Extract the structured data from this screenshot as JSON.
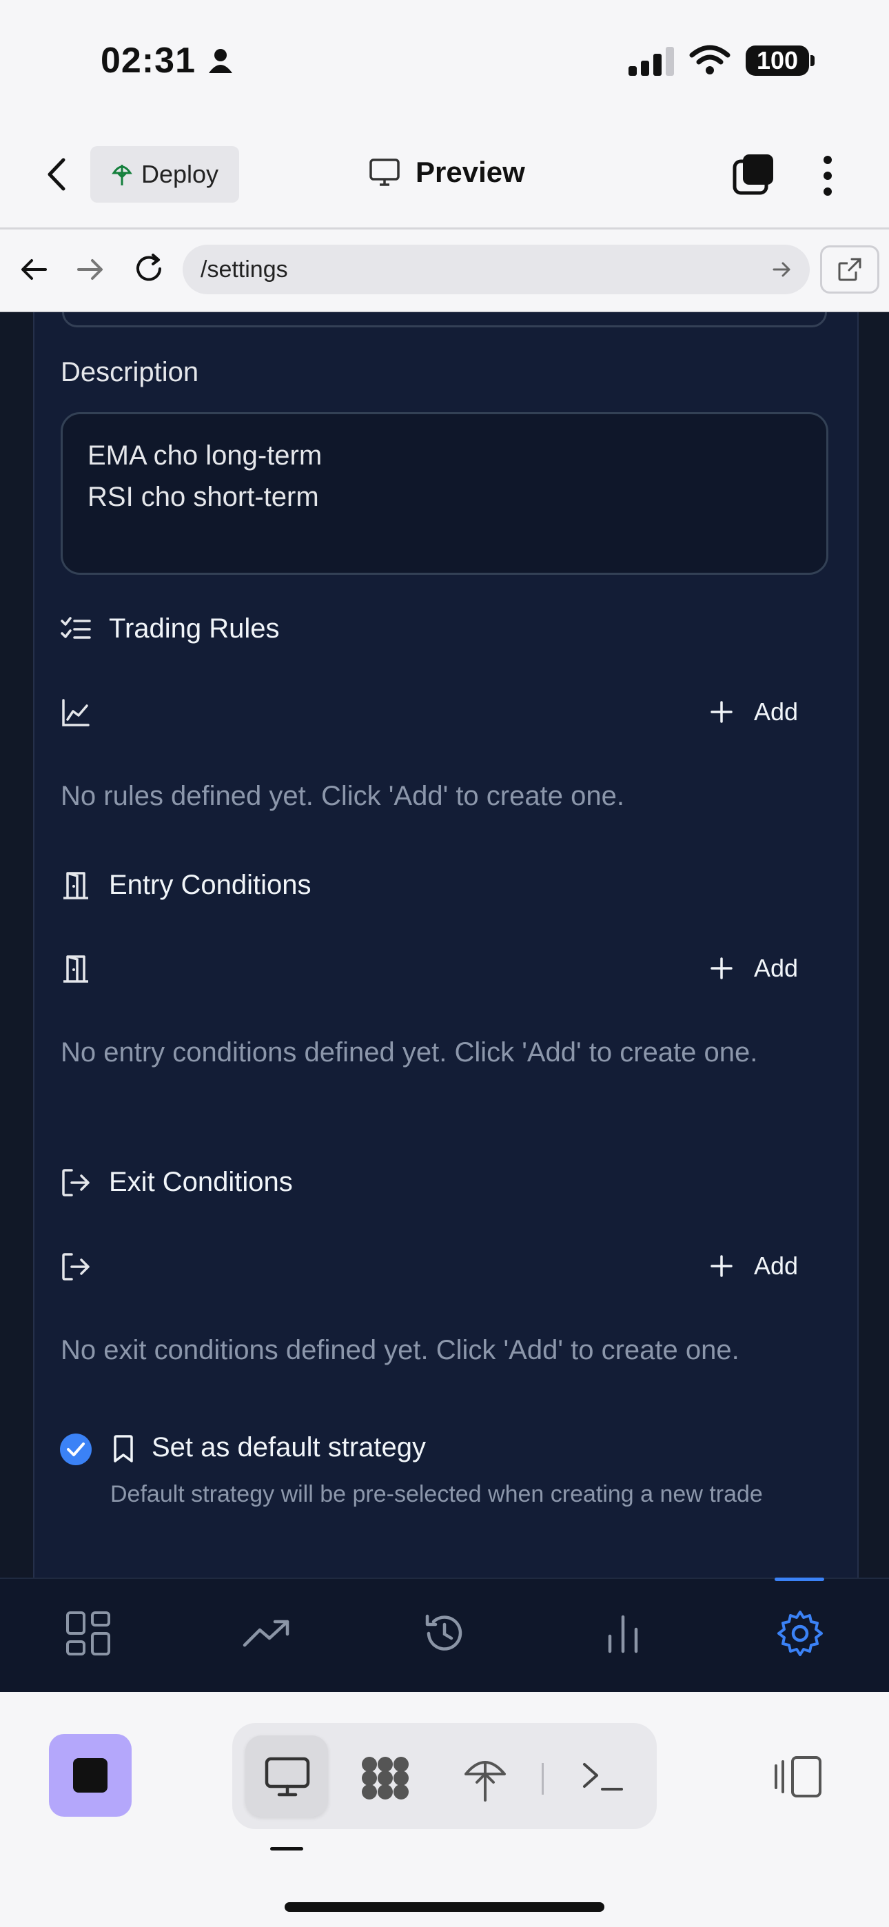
{
  "status_bar": {
    "time": "02:31",
    "battery": "100"
  },
  "header": {
    "deploy_label": "Deploy",
    "title": "Preview"
  },
  "browser": {
    "url": "/settings"
  },
  "form": {
    "description_label": "Description",
    "description_value": "EMA cho long-term\nRSI cho short-term",
    "trading_rules": {
      "title": "Trading Rules",
      "add_label": "Add",
      "empty": "No rules defined yet. Click 'Add' to create one."
    },
    "entry_conditions": {
      "title": "Entry Conditions",
      "add_label": "Add",
      "empty": "No entry conditions defined yet. Click 'Add' to create one."
    },
    "exit_conditions": {
      "title": "Exit Conditions",
      "add_label": "Add",
      "empty": "No exit conditions defined yet. Click 'Add' to create one."
    },
    "default_strategy": {
      "checked": true,
      "label": "Set as default strategy",
      "hint": "Default strategy will be pre-selected when creating a new trade"
    }
  },
  "tabbar": {
    "items": [
      "dashboard-icon",
      "trending-up-icon",
      "history-icon",
      "bar-chart-icon",
      "settings-icon"
    ],
    "active": "settings-icon"
  },
  "colors": {
    "accent": "#3b82f6",
    "card": "#131d36",
    "stop": "#b4a7fb"
  }
}
